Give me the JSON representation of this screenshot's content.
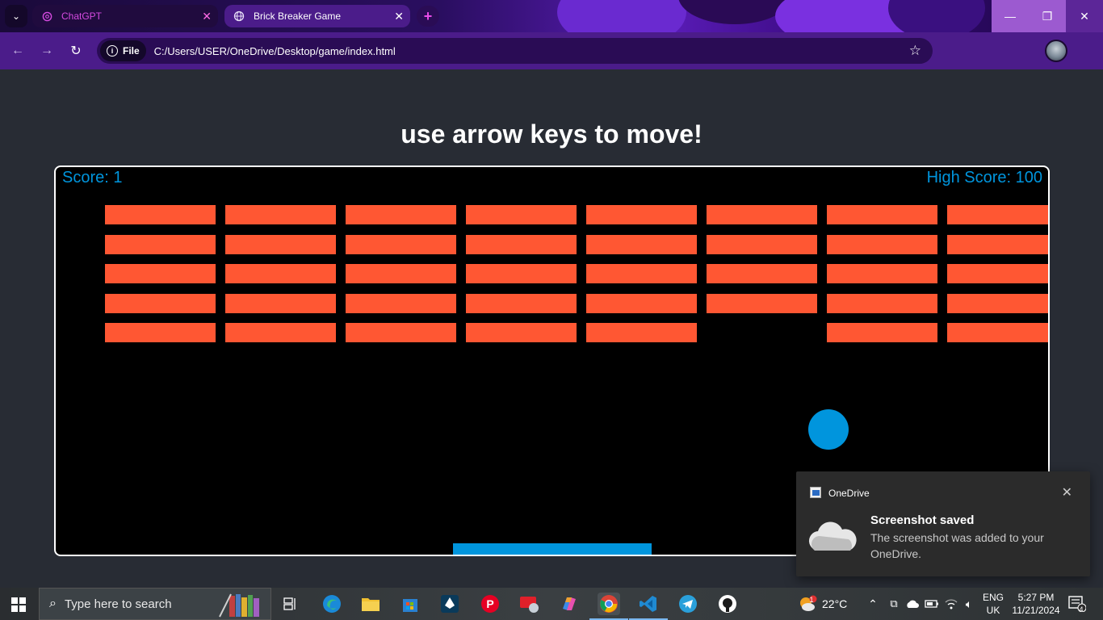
{
  "browser": {
    "tabs": [
      {
        "label": "ChatGPT",
        "active": false
      },
      {
        "label": "Brick Breaker Game",
        "active": true
      }
    ],
    "new_tab_symbol": "+",
    "file_chip_label": "File",
    "url": "C:/Users/USER/OneDrive/Desktop/game/index.html",
    "window_controls": [
      "minimize",
      "maximize",
      "close"
    ]
  },
  "page": {
    "title": "use arrow keys to move!"
  },
  "game": {
    "score_text": "Score: 1",
    "high_score_text": "High Score: 100",
    "brick_color": "#ff5733",
    "ball_color": "#0095dd",
    "paddle_color": "#0095dd",
    "brick_rows": [
      [
        1,
        1,
        1,
        1,
        1,
        1,
        1,
        1
      ],
      [
        1,
        1,
        1,
        1,
        1,
        1,
        1,
        1
      ],
      [
        1,
        1,
        1,
        1,
        1,
        1,
        1,
        1
      ],
      [
        1,
        1,
        1,
        1,
        1,
        1,
        1,
        1
      ],
      [
        1,
        1,
        1,
        1,
        1,
        0,
        1,
        1
      ]
    ]
  },
  "toast": {
    "app": "OneDrive",
    "title": "Screenshot saved",
    "body": "The screenshot was added to your OneDrive."
  },
  "taskbar": {
    "search_placeholder": "Type here to search",
    "weather_temp": "22°C",
    "weather_badge": "1",
    "lang_top": "ENG",
    "lang_bottom": "UK",
    "time": "5:27 PM",
    "date": "11/21/2024",
    "notification_count": "4",
    "apps": [
      "task-view",
      "edge",
      "file-explorer",
      "microsoft-store",
      "inkscape",
      "pinterest",
      "app-red",
      "copilot",
      "chrome",
      "vscode",
      "telegram",
      "github"
    ]
  }
}
